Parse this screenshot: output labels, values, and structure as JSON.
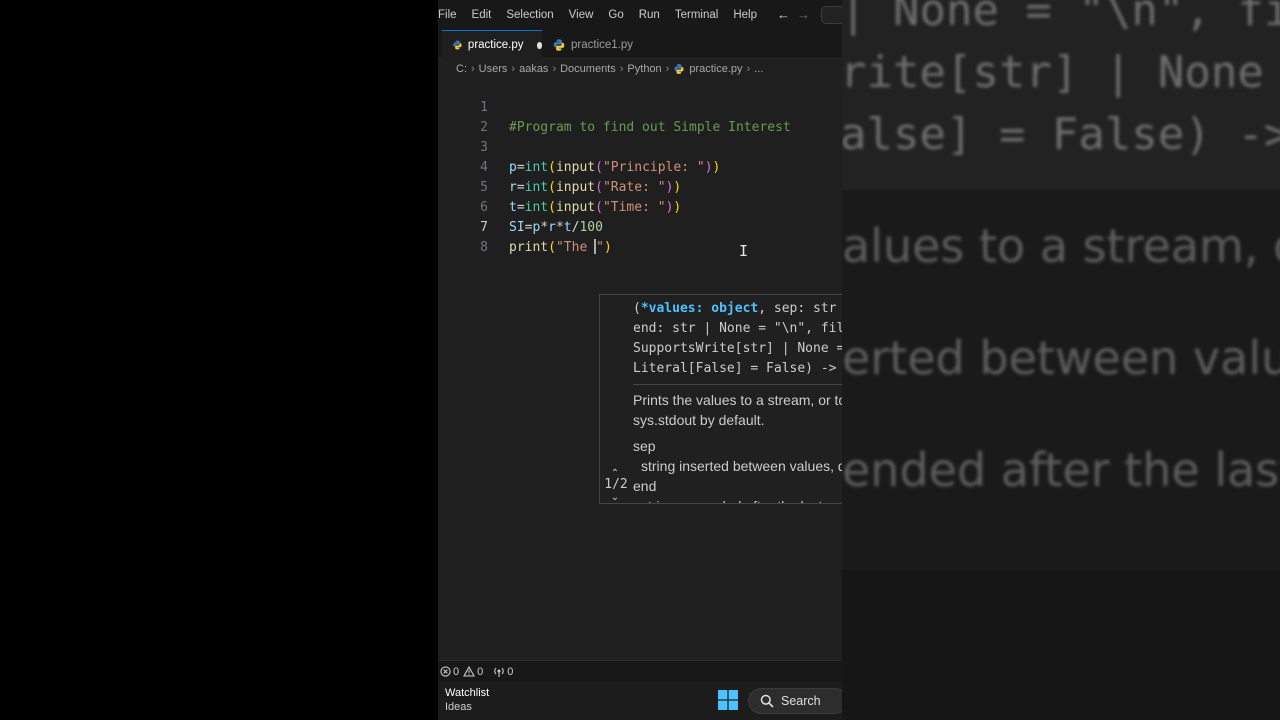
{
  "menu": [
    "File",
    "Edit",
    "Selection",
    "View",
    "Go",
    "Run",
    "Terminal",
    "Help"
  ],
  "tabs": [
    {
      "label": "practice.py",
      "active": true,
      "modified": true
    },
    {
      "label": "practice1.py",
      "active": false,
      "modified": false
    }
  ],
  "breadcrumb": [
    "C:",
    "Users",
    "aakas",
    "Documents",
    "Python",
    "practice.py",
    "..."
  ],
  "editor": {
    "line_numbers": [
      "1",
      "2",
      "3",
      "4",
      "5",
      "6",
      "7",
      "8"
    ],
    "current_line": 7
  },
  "signature_help": {
    "line1_open": "(",
    "line1_param": "*values: object",
    "line1_rest": ", sep: str | None = \" \",",
    "line2": "end: str | None = \"\\n\", file:",
    "line3": "SupportsWrite[str] | None = None, flush:",
    "line4": "Literal[False] = False) -> None",
    "doc": "Prints the values to a stream, or to sys.stdout by default.",
    "param_sep": "sep",
    "param_sep_desc": "string inserted between values, default a space.",
    "param_end": "end",
    "param_end_desc": "string appended after the last value, default a newline.",
    "pager": "1/2"
  },
  "status": {
    "errors": "0",
    "warnings": "0",
    "ports": "0"
  },
  "taskbar": {
    "widget_title": "Watchlist",
    "widget_sub": "Ideas",
    "search_label": "Search"
  },
  "background_zoom": {
    "line1": "| None = \"\\n\", fi",
    "line2": "rite[str] | None",
    "line3": "alse] = False) -> ",
    "text1": "alues to a stream, or",
    "text2": "erted between values",
    "text3": "ended after the last"
  },
  "colors": {
    "accent": "#0078d4",
    "editor_bg": "#1f1f1f",
    "comment": "#6a9955",
    "string": "#ce9178",
    "keyword_fn": "#dcdcaa",
    "builtin_class": "#4ec9b0",
    "variable": "#9cdcfe",
    "param_highlight": "#4fc1ff"
  }
}
